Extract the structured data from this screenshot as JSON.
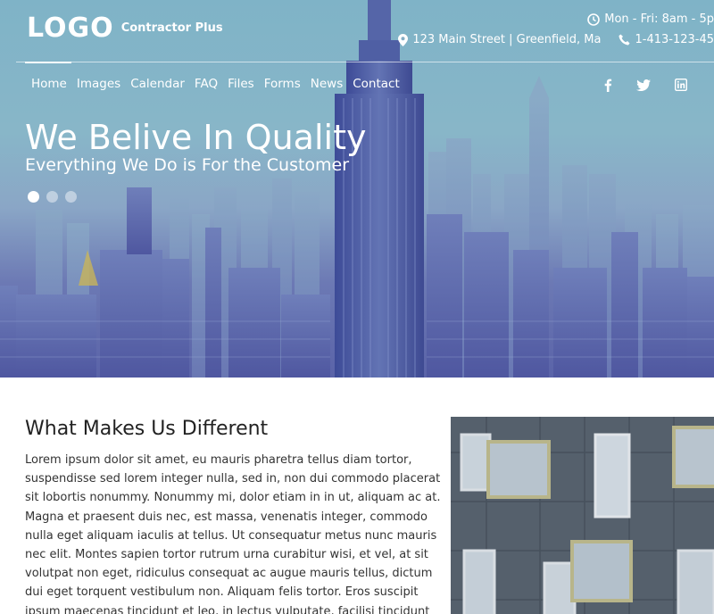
{
  "header": {
    "logo_text": "LOGO",
    "logo_subtitle": "Contractor Plus",
    "hours": "Mon - Fri: 8am - 5p",
    "address": "123 Main Street | Greenfield, Ma",
    "phone": "1-413-123-45"
  },
  "nav": {
    "items": [
      "Home",
      "Images",
      "Calendar",
      "FAQ",
      "Files",
      "Forms",
      "News",
      "Contact"
    ],
    "active": "Home"
  },
  "social": [
    "facebook-icon",
    "twitter-icon",
    "linkedin-icon"
  ],
  "hero": {
    "headline": "We Belive In Quality",
    "subheadline": "Everything We Do is For the Customer",
    "slides": 3,
    "active_slide": 1
  },
  "main": {
    "title": "What Makes Us Different",
    "body": "Lorem ipsum dolor sit amet, eu mauris pharetra tellus diam tortor, suspendisse sed lorem integer nulla, sed in, non dui commodo placerat sit lobortis nonummy. Nonummy mi, dolor etiam in in ut, aliquam ac at. Magna et praesent duis nec, est massa, venenatis integer, commodo nulla eget aliquam iaculis at tellus. Ut consequatur metus nunc mauris nec elit. Montes sapien tortor rutrum urna curabitur wisi, et vel, at sit volutpat non eget, ridiculus consequat ac augue mauris tellus, dictum dui eget torquent vestibulum non. Aliquam felis tortor. Eros suscipit ipsum maecenas tincidunt et leo, in lectus vulputate, facilisi tincidunt lorem, et tristique"
  },
  "colors": {
    "hero_sky": "#88b6c8",
    "hero_city": "#5a63a8",
    "text_dark": "#222222",
    "white": "#ffffff"
  }
}
